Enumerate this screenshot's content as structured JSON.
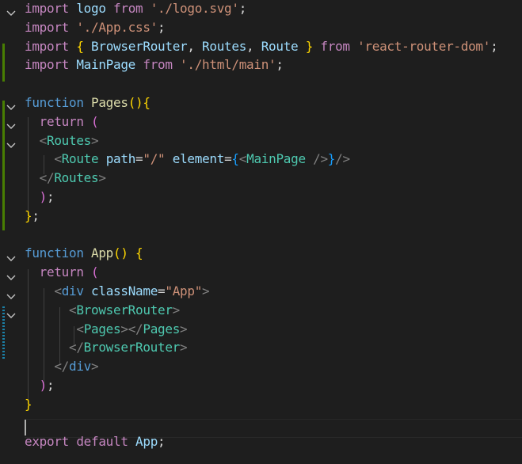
{
  "editor": {
    "language": "javascript-react",
    "theme_colors": {
      "background": "#1e1e1e",
      "keyword": "#c586c0",
      "storage": "#569cd6",
      "variable": "#9cdcfe",
      "function": "#dcdcaa",
      "string": "#ce9178",
      "component_tag": "#4ec9b0",
      "added_gutter": "#487e02",
      "modified_gutter": "#1b81a8"
    },
    "lines": [
      {
        "tokens": [
          "import",
          " ",
          "logo",
          " ",
          "from",
          " ",
          "'./logo.svg'",
          ";"
        ]
      },
      {
        "tokens": [
          "import",
          " ",
          "'./App.css'",
          ";"
        ]
      },
      {
        "tokens": [
          "import",
          " ",
          "{",
          " ",
          "BrowserRouter",
          ", ",
          "Routes",
          ", ",
          "Route",
          " ",
          "}",
          " ",
          "from",
          " ",
          "'react-router-dom'",
          ";"
        ]
      },
      {
        "tokens": [
          "import",
          " ",
          "MainPage",
          " ",
          "from",
          " ",
          "'./html/main'",
          ";"
        ]
      },
      {
        "tokens": []
      },
      {
        "tokens": [
          "function",
          " ",
          "Pages",
          "(",
          ")",
          "{"
        ]
      },
      {
        "tokens": [
          "  ",
          "return",
          " ",
          "("
        ]
      },
      {
        "tokens": [
          "  ",
          "<",
          "Routes",
          ">"
        ]
      },
      {
        "tokens": [
          "    ",
          "<",
          "Route",
          " ",
          "path",
          "=",
          "\"/\"",
          " ",
          "element",
          "=",
          "{",
          "<",
          "MainPage",
          " ",
          "/>",
          "}",
          "/>"
        ]
      },
      {
        "tokens": [
          "  ",
          "</",
          "Routes",
          ">"
        ]
      },
      {
        "tokens": [
          "  ",
          ")",
          ";"
        ]
      },
      {
        "tokens": [
          "}",
          ";"
        ]
      },
      {
        "tokens": []
      },
      {
        "tokens": [
          "function",
          " ",
          "App",
          "(",
          ")",
          " ",
          "{"
        ]
      },
      {
        "tokens": [
          "  ",
          "return",
          " ",
          "("
        ]
      },
      {
        "tokens": [
          "    ",
          "<",
          "div",
          " ",
          "className",
          "=",
          "\"App\"",
          ">"
        ]
      },
      {
        "tokens": [
          "      ",
          "<",
          "BrowserRouter",
          ">"
        ]
      },
      {
        "tokens": [
          "       ",
          "<",
          "Pages",
          ">",
          "</",
          "Pages",
          ">"
        ]
      },
      {
        "tokens": [
          "      ",
          "</",
          "BrowserRouter",
          ">"
        ]
      },
      {
        "tokens": [
          "    ",
          "</",
          "div",
          ">"
        ]
      },
      {
        "tokens": [
          "  ",
          ")",
          ";"
        ]
      },
      {
        "tokens": [
          "}"
        ]
      },
      {
        "tokens": []
      },
      {
        "tokens": [
          "export",
          " ",
          "default",
          " ",
          "App",
          ";"
        ]
      }
    ]
  }
}
